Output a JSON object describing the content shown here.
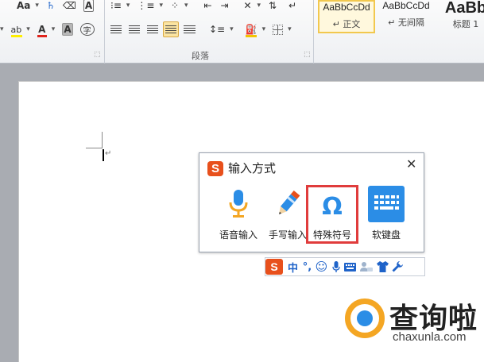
{
  "ribbon": {
    "font_size_label": "Aa",
    "font_size_dd": "▾",
    "font_color_letter": "A",
    "char_shading_letter": "A",
    "enclosed_char": "字",
    "highlight_letter": "ab",
    "paragraph_group_label": "段落",
    "launcher_glyph": "⬚"
  },
  "styles": [
    {
      "sample": "AaBbCcDd",
      "name": "↵ 正文",
      "selected": true
    },
    {
      "sample": "AaBbCcDd",
      "name": "↵ 无间隔",
      "selected": false
    },
    {
      "sample": "AaBb",
      "name": "标题 1",
      "selected": false
    }
  ],
  "document": {
    "paragraph_mark": "↵"
  },
  "ime_panel": {
    "logo": "S",
    "title": "输入方式",
    "close": "✕",
    "items": [
      {
        "label": "语音输入",
        "icon": "microphone-icon"
      },
      {
        "label": "手写输入",
        "icon": "pencil-icon"
      },
      {
        "label": "特殊符号",
        "icon": "omega-icon",
        "glyph": "Ω",
        "highlighted": true
      },
      {
        "label": "软键盘",
        "icon": "keyboard-icon"
      }
    ]
  },
  "ime_toolbar": {
    "logo": "S",
    "lang": "中",
    "punct": "°,",
    "emoji": "☺",
    "items": [
      "microphone-icon",
      "keyboard-icon",
      "user-icon",
      "skin-icon",
      "wrench-icon"
    ]
  },
  "watermark": {
    "text": "查询啦",
    "sub": "chaxunla.com"
  },
  "colors": {
    "accent_red": "#e03c3c",
    "sogou_orange": "#e8501c",
    "icon_blue": "#2b8de6",
    "watermark_orange": "#f4a623"
  }
}
